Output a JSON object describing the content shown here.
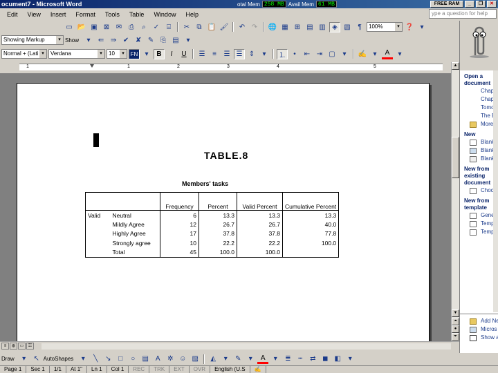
{
  "window": {
    "title": "ocument7 - Microsoft Word",
    "mem_total_label": "otal Mem",
    "mem_total_value": "258 MB",
    "mem_avail_label": "Avail Mem",
    "mem_avail_value": "61 MB",
    "free_ram_label": "FREE RAM"
  },
  "menu": {
    "items": [
      "Edit",
      "View",
      "Insert",
      "Format",
      "Tools",
      "Table",
      "Window",
      "Help"
    ],
    "ask_placeholder": "ype a question for help"
  },
  "toolbar": {
    "zoom": "100%",
    "markup_combo": "Showing Markup",
    "show_label": "Show",
    "style_combo": "Normal + (Lati",
    "font_combo": "Verdana",
    "size_combo": "10",
    "bold": "B",
    "italic": "I",
    "underline": "U",
    "highlight_color": "#ffff00",
    "font_color": "#ff0000"
  },
  "ruler": {
    "marks": [
      "1",
      "1",
      "2",
      "3",
      "4",
      "5"
    ]
  },
  "document": {
    "heading": "TABLE.8",
    "table_caption": "Members' tasks",
    "table": {
      "headers": [
        "Frequency",
        "Percent",
        "Valid Percent",
        "Cumulative Percent"
      ],
      "group_label": "Valid",
      "rows": [
        {
          "label": "Neutral",
          "frequency": "6",
          "percent": "13.3",
          "valid_percent": "13.3",
          "cumulative": "13.3"
        },
        {
          "label": "Mildly Agree",
          "frequency": "12",
          "percent": "26.7",
          "valid_percent": "26.7",
          "cumulative": "40.0"
        },
        {
          "label": "Highly Agree",
          "frequency": "17",
          "percent": "37.8",
          "valid_percent": "37.8",
          "cumulative": "77.8"
        },
        {
          "label": "Strongly agree",
          "frequency": "10",
          "percent": "22.2",
          "valid_percent": "22.2",
          "cumulative": "100.0"
        },
        {
          "label": "Total",
          "frequency": "45",
          "percent": "100.0",
          "valid_percent": "100.0",
          "cumulative": ""
        }
      ]
    }
  },
  "taskpane": {
    "open_header": "Open a document",
    "open_links": [
      "Chapter fo",
      "Chapter fo",
      "Tomorrow",
      "The Ele",
      "More do"
    ],
    "new_header": "New",
    "new_links": [
      "Blank d",
      "Blank w",
      "Blank e"
    ],
    "existing_header": "New from existing document",
    "existing_links": [
      "Choose"
    ],
    "template_header": "New from template",
    "template_links": [
      "Genera",
      "Templa",
      "Templa"
    ],
    "bottom_links": [
      "Add Ne",
      "Micros",
      "Show a"
    ]
  },
  "drawbar": {
    "draw_label": "Draw",
    "autoshapes_label": "AutoShapes"
  },
  "status": {
    "page": "Page 1",
    "sec": "Sec 1",
    "page_of": "1/1",
    "at": "At 1\"",
    "ln": "Ln 1",
    "col": "Col 1",
    "rec": "REC",
    "trk": "TRK",
    "ext": "EXT",
    "ovr": "OVR",
    "lang": "English (U.S"
  }
}
